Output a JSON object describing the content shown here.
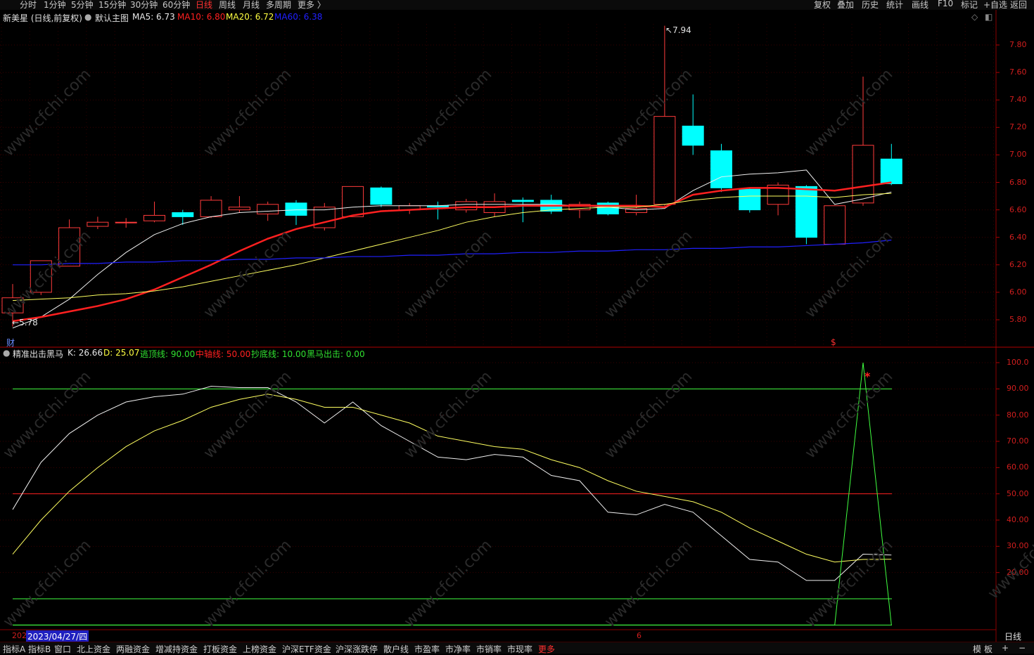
{
  "top_menu": {
    "periods": [
      "分时",
      "1分钟",
      "5分钟",
      "15分钟",
      "30分钟",
      "60分钟",
      "日线",
      "周线",
      "月线",
      "多周期",
      "更多 〉"
    ],
    "active_period": "日线",
    "right_buttons": [
      "复权",
      "叠加",
      "历史",
      "统计",
      "画线",
      "F10",
      "标记",
      "+自选",
      "返回"
    ]
  },
  "main_chart": {
    "stock_label": "新美星 (日线,前复权)",
    "template_label": "默认主图",
    "ma": [
      {
        "name": "MA5",
        "value": "MA5: 6.73",
        "color": "#ffffff"
      },
      {
        "name": "MA10",
        "value": "MA10: 6.80",
        "color": "#ff2020"
      },
      {
        "name": "MA20",
        "value": "MA20: 6.72",
        "color": "#ffff60"
      },
      {
        "name": "MA60",
        "value": "MA60: 6.38",
        "color": "#2020ff"
      }
    ],
    "high_marker": "7.94",
    "low_marker": "5.78",
    "finance_badge": "财",
    "dollar_badge": "$",
    "y_ticks": [
      "7.80",
      "7.60",
      "7.40",
      "7.20",
      "7.00",
      "6.80",
      "6.60",
      "6.40",
      "6.20",
      "6.00",
      "5.80"
    ]
  },
  "indicator": {
    "name": "精准出击黑马",
    "k": "K: 26.66",
    "d": "D: 25.07",
    "line_top": "逃顶线: 90.00",
    "line_mid": "中轴线: 50.00",
    "line_bottom": "抄底线: 10.00",
    "signal": "黑马出击: 0.00",
    "star": "*",
    "y_ticks": [
      "100.0",
      "90.00",
      "80.00",
      "70.00",
      "60.00",
      "50.00",
      "40.00",
      "30.00",
      "20.00"
    ]
  },
  "date_bar": {
    "prefix": "202",
    "cursor_date": "2023/04/27/四",
    "month_mark": "6",
    "period_label": "日线"
  },
  "bottom_tabs": [
    "指标A",
    "指标B",
    "窗口",
    "北上资金",
    "两融资金",
    "增减持资金",
    "打板资金",
    "上榜资金",
    "沪深ETF资金",
    "沪深涨跌停",
    "散户线",
    "市盈率",
    "市净率",
    "市销率",
    "市现率",
    "更多"
  ],
  "bottom_right": [
    "模",
    "板",
    "+",
    "−"
  ],
  "watermark": "www.cfchi.com",
  "chart_data": [
    {
      "type": "candlestick",
      "title": "新美星 (日线,前复权)",
      "ylim": [
        5.7,
        7.95
      ],
      "candles": [
        {
          "o": 5.85,
          "c": 5.96,
          "h": 6.06,
          "l": 5.75
        },
        {
          "o": 6.0,
          "c": 6.23,
          "h": 6.23,
          "l": 5.98
        },
        {
          "o": 6.19,
          "c": 6.47,
          "h": 6.53,
          "l": 6.19
        },
        {
          "o": 6.48,
          "c": 6.51,
          "h": 6.55,
          "l": 6.46
        },
        {
          "o": 6.51,
          "c": 6.51,
          "h": 6.54,
          "l": 6.47
        },
        {
          "o": 6.52,
          "c": 6.56,
          "h": 6.66,
          "l": 6.51
        },
        {
          "o": 6.58,
          "c": 6.55,
          "h": 6.6,
          "l": 6.49
        },
        {
          "o": 6.55,
          "c": 6.67,
          "h": 6.7,
          "l": 6.54
        },
        {
          "o": 6.6,
          "c": 6.62,
          "h": 6.7,
          "l": 6.58
        },
        {
          "o": 6.57,
          "c": 6.64,
          "h": 6.66,
          "l": 6.52
        },
        {
          "o": 6.65,
          "c": 6.56,
          "h": 6.67,
          "l": 6.49
        },
        {
          "o": 6.47,
          "c": 6.62,
          "h": 6.65,
          "l": 6.45
        },
        {
          "o": 6.55,
          "c": 6.77,
          "h": 6.77,
          "l": 6.55
        },
        {
          "o": 6.76,
          "c": 6.64,
          "h": 6.77,
          "l": 6.62
        },
        {
          "o": 6.6,
          "c": 6.63,
          "h": 6.65,
          "l": 6.57
        },
        {
          "o": 6.63,
          "c": 6.62,
          "h": 6.66,
          "l": 6.53
        },
        {
          "o": 6.6,
          "c": 6.66,
          "h": 6.68,
          "l": 6.58
        },
        {
          "o": 6.58,
          "c": 6.66,
          "h": 6.72,
          "l": 6.55
        },
        {
          "o": 6.67,
          "c": 6.66,
          "h": 6.69,
          "l": 6.51
        },
        {
          "o": 6.67,
          "c": 6.59,
          "h": 6.71,
          "l": 6.57
        },
        {
          "o": 6.6,
          "c": 6.64,
          "h": 6.66,
          "l": 6.54
        },
        {
          "o": 6.65,
          "c": 6.57,
          "h": 6.66,
          "l": 6.56
        },
        {
          "o": 6.58,
          "c": 6.61,
          "h": 6.71,
          "l": 6.56
        },
        {
          "o": 6.64,
          "c": 7.28,
          "h": 7.94,
          "l": 6.63
        },
        {
          "o": 7.21,
          "c": 7.07,
          "h": 7.44,
          "l": 7.0
        },
        {
          "o": 7.03,
          "c": 6.76,
          "h": 7.08,
          "l": 6.73
        },
        {
          "o": 6.75,
          "c": 6.6,
          "h": 6.76,
          "l": 6.58
        },
        {
          "o": 6.64,
          "c": 6.78,
          "h": 6.8,
          "l": 6.56
        },
        {
          "o": 6.77,
          "c": 6.4,
          "h": 6.78,
          "l": 6.35
        },
        {
          "o": 6.35,
          "c": 6.63,
          "h": 6.63,
          "l": 6.35
        },
        {
          "o": 6.65,
          "c": 7.07,
          "h": 7.57,
          "l": 6.63
        },
        {
          "o": 6.97,
          "c": 6.79,
          "h": 7.08,
          "l": 6.78
        }
      ],
      "series": [
        {
          "name": "MA5",
          "values": [
            5.74,
            5.82,
            5.95,
            6.13,
            6.29,
            6.42,
            6.5,
            6.55,
            6.58,
            6.59,
            6.6,
            6.6,
            6.62,
            6.63,
            6.63,
            6.63,
            6.64,
            6.64,
            6.64,
            6.64,
            6.63,
            6.62,
            6.6,
            6.61,
            6.74,
            6.84,
            6.86,
            6.87,
            6.89,
            6.64,
            6.68,
            6.73
          ]
        },
        {
          "name": "MA10",
          "values": [
            5.79,
            5.82,
            5.86,
            5.9,
            5.95,
            6.02,
            6.11,
            6.2,
            6.3,
            6.39,
            6.46,
            6.51,
            6.56,
            6.59,
            6.6,
            6.61,
            6.62,
            6.62,
            6.63,
            6.63,
            6.63,
            6.63,
            6.63,
            6.62,
            6.71,
            6.74,
            6.76,
            6.76,
            6.75,
            6.74,
            6.77,
            6.8
          ]
        },
        {
          "name": "MA20",
          "values": [
            5.94,
            5.95,
            5.96,
            5.98,
            5.99,
            6.01,
            6.04,
            6.08,
            6.12,
            6.16,
            6.2,
            6.25,
            6.3,
            6.35,
            6.4,
            6.45,
            6.51,
            6.55,
            6.58,
            6.6,
            6.61,
            6.62,
            6.62,
            6.64,
            6.67,
            6.69,
            6.7,
            6.7,
            6.7,
            6.69,
            6.71,
            6.72
          ]
        },
        {
          "name": "MA60",
          "values": [
            6.2,
            6.2,
            6.21,
            6.21,
            6.22,
            6.22,
            6.23,
            6.23,
            6.24,
            6.24,
            6.25,
            6.25,
            6.26,
            6.26,
            6.27,
            6.27,
            6.28,
            6.28,
            6.29,
            6.29,
            6.3,
            6.3,
            6.31,
            6.31,
            6.32,
            6.32,
            6.33,
            6.33,
            6.34,
            6.35,
            6.36,
            6.38
          ]
        }
      ]
    },
    {
      "type": "line",
      "title": "精准出击黑马",
      "ylim": [
        0,
        103
      ],
      "horizontal_lines": [
        90,
        50,
        10
      ],
      "series": [
        {
          "name": "K",
          "values": [
            44,
            62,
            73,
            80,
            85,
            87,
            88,
            91,
            90.5,
            90.5,
            85,
            77,
            85,
            76,
            70,
            64,
            63,
            65,
            64,
            57,
            55,
            43,
            42,
            46,
            43,
            34,
            25,
            24,
            17,
            17,
            27,
            26.66
          ]
        },
        {
          "name": "D",
          "values": [
            27,
            40,
            51,
            60,
            68,
            74,
            78,
            83,
            86,
            88,
            86,
            83,
            83,
            80,
            77,
            72,
            70,
            68,
            67,
            63,
            60,
            55,
            51,
            49,
            47,
            43,
            37,
            32,
            27,
            24,
            25,
            25.07
          ]
        },
        {
          "name": "黑马出击",
          "values": [
            0,
            0,
            0,
            0,
            0,
            0,
            0,
            0,
            0,
            0,
            0,
            0,
            0,
            0,
            0,
            0,
            0,
            0,
            0,
            0,
            0,
            0,
            0,
            0,
            0,
            0,
            0,
            0,
            0,
            0,
            100,
            0
          ]
        }
      ]
    }
  ]
}
